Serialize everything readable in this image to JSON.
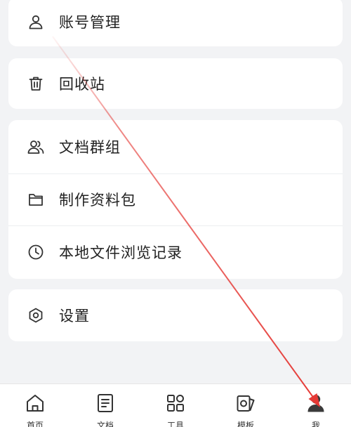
{
  "menu": {
    "account": "账号管理",
    "recycle": "回收站",
    "doc_groups": "文档群组",
    "make_pack": "制作资料包",
    "local_history": "本地文件浏览记录",
    "settings": "设置"
  },
  "tabs": {
    "home": "首页",
    "docs": "文档",
    "tools": "工具",
    "templates": "模板",
    "me": "我"
  },
  "colors": {
    "annotation_arrow": "#e53935",
    "icon_stroke": "#333333"
  }
}
